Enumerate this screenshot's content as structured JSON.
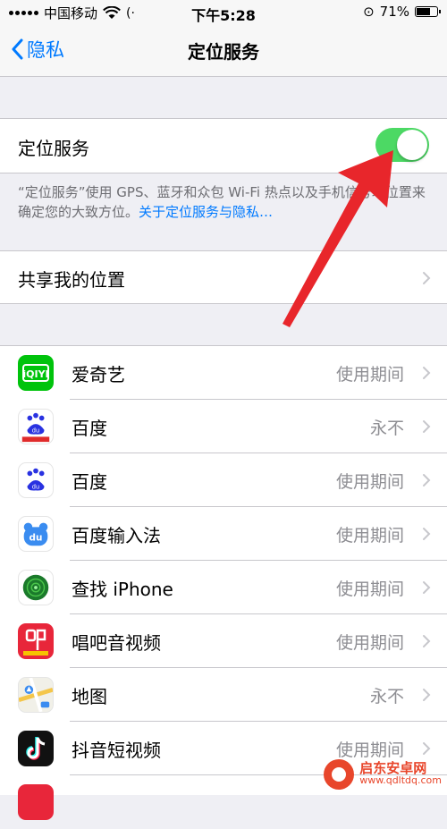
{
  "status_bar": {
    "carrier": "中国移动",
    "time": "下午5:28",
    "battery": "71%",
    "battery_level": 0.71
  },
  "nav": {
    "back_label": "隐私",
    "title": "定位服务"
  },
  "location_services": {
    "label": "定位服务",
    "enabled": true,
    "footer": "“定位服务”使用 GPS、蓝牙和众包 Wi-Fi 热点以及手机信号塔位置来确定您的大致方位。",
    "footer_link": "关于定位服务与隐私…"
  },
  "share_location": {
    "label": "共享我的位置"
  },
  "apps": [
    {
      "name": "爱奇艺",
      "status": "使用期间",
      "icon": "iqiyi-icon"
    },
    {
      "name": "百度",
      "status": "永不",
      "icon": "baidu-icon"
    },
    {
      "name": "百度",
      "status": "使用期间",
      "icon": "baidu-icon"
    },
    {
      "name": "百度输入法",
      "status": "使用期间",
      "icon": "baidu-input-icon"
    },
    {
      "name": "查找 iPhone",
      "status": "使用期间",
      "icon": "find-iphone-icon"
    },
    {
      "name": "唱吧音视频",
      "status": "使用期间",
      "icon": "changba-icon"
    },
    {
      "name": "地图",
      "status": "永不",
      "icon": "maps-icon"
    },
    {
      "name": "抖音短视频",
      "status": "使用期间",
      "icon": "douyin-icon"
    }
  ],
  "watermark": {
    "title": "启东安卓网",
    "url": "www.qdltdq.com"
  },
  "colors": {
    "accent": "#007aff",
    "toggle_on": "#4cd964",
    "annotation_arrow": "#e8262b"
  }
}
